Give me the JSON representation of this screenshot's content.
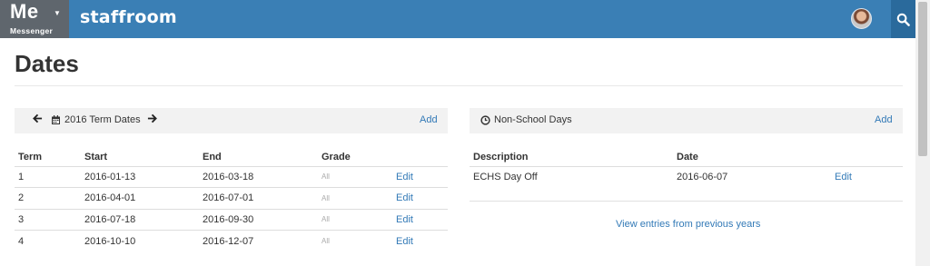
{
  "topbar": {
    "app_name": "Me",
    "app_sub": "Messenger",
    "brand": "staffroom"
  },
  "page": {
    "title": "Dates"
  },
  "term_dates": {
    "heading": "2016 Term Dates",
    "add_label": "Add",
    "columns": [
      "Term",
      "Start",
      "End",
      "Grade",
      ""
    ],
    "rows": [
      {
        "term": "1",
        "start": "2016-01-13",
        "end": "2016-03-18",
        "grade": "All",
        "action": "Edit"
      },
      {
        "term": "2",
        "start": "2016-04-01",
        "end": "2016-07-01",
        "grade": "All",
        "action": "Edit"
      },
      {
        "term": "3",
        "start": "2016-07-18",
        "end": "2016-09-30",
        "grade": "All",
        "action": "Edit"
      },
      {
        "term": "4",
        "start": "2016-10-10",
        "end": "2016-12-07",
        "grade": "All",
        "action": "Edit"
      }
    ]
  },
  "non_school_days": {
    "heading": "Non-School Days",
    "add_label": "Add",
    "columns": [
      "Description",
      "Date",
      ""
    ],
    "rows": [
      {
        "description": "ECHS Day Off",
        "date": "2016-06-07",
        "action": "Edit"
      }
    ],
    "previous_link": "View entries from previous years"
  },
  "colors": {
    "topbar": "#3a7fb5",
    "app_switch": "#5f666d",
    "link": "#337ab7",
    "panel_head": "#f2f2f2"
  },
  "icons": [
    "caret-down-icon",
    "avatar",
    "search-icon",
    "arrow-left-icon",
    "calendar-icon",
    "arrow-right-icon",
    "clock-icon"
  ]
}
